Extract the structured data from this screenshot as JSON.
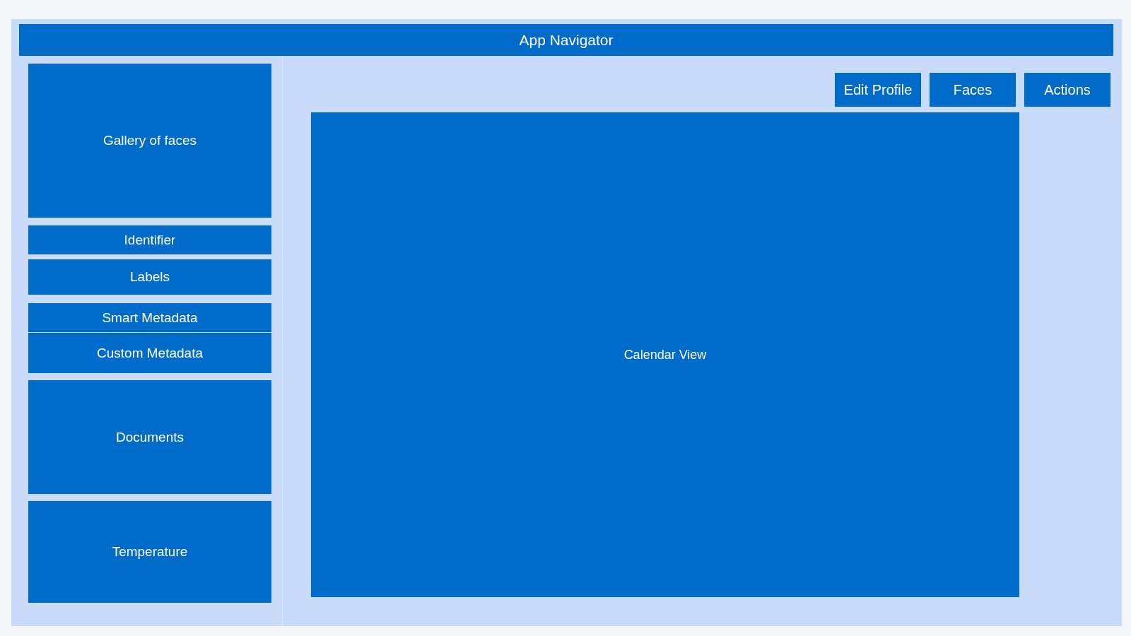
{
  "header": {
    "title": "App Navigator"
  },
  "sidebar": {
    "items": [
      {
        "label": "Gallery of faces"
      },
      {
        "label": "Identifier"
      },
      {
        "label": "Labels"
      },
      {
        "label": "Smart Metadata"
      },
      {
        "label": "Custom Metadata"
      },
      {
        "label": "Documents"
      },
      {
        "label": "Temperature"
      }
    ]
  },
  "toolbar": {
    "buttons": [
      "Edit Profile",
      "Faces",
      "Actions"
    ]
  },
  "main": {
    "label": "Calendar View"
  }
}
